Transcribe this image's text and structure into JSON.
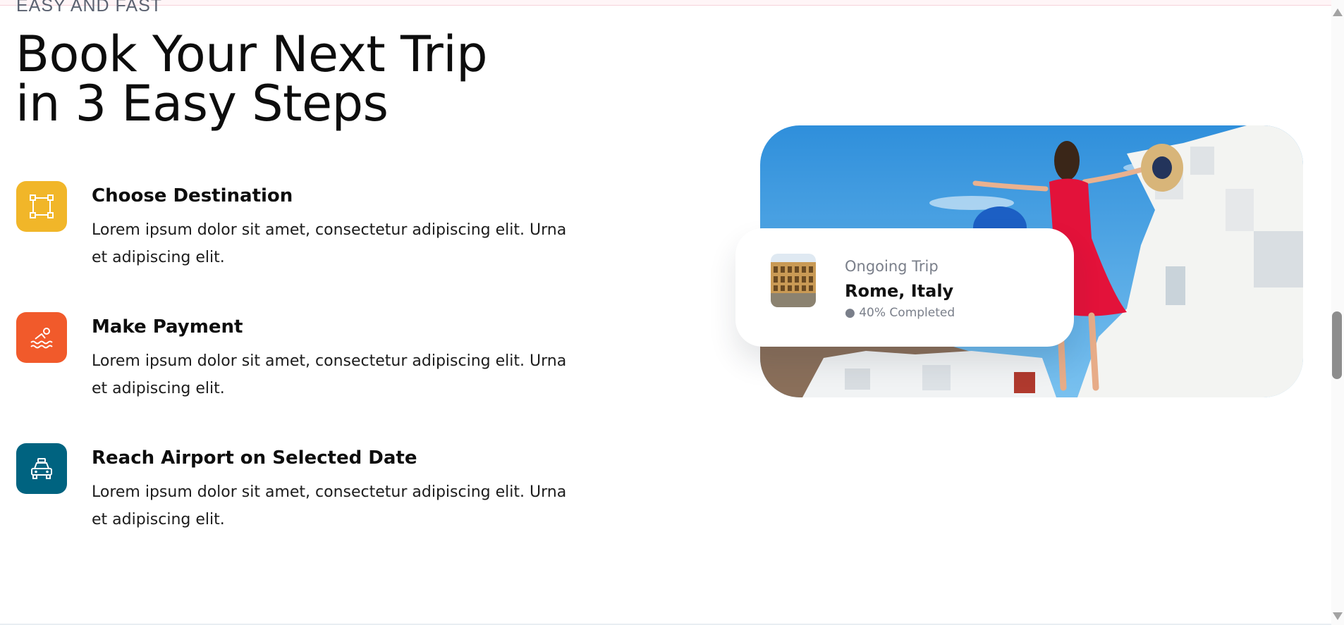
{
  "section": {
    "eyebrow": "EASY AND FAST",
    "title_line1": "Book Your Next Trip",
    "title_line2": "in 3 Easy Steps"
  },
  "steps": [
    {
      "title": "Choose Destination",
      "text": "Lorem ipsum dolor sit amet, consectetur adipiscing elit. Urna et adipiscing elit.",
      "icon": "selection-icon",
      "color": "#F1B629"
    },
    {
      "title": "Make Payment",
      "text": "Lorem ipsum dolor sit amet, consectetur adipiscing elit. Urna et adipiscing elit.",
      "icon": "swimmer-icon",
      "color": "#F15A2B"
    },
    {
      "title": "Reach Airport on Selected Date",
      "text": "Lorem ipsum dolor sit amet, consectetur adipiscing elit. Urna et adipiscing elit.",
      "icon": "taxi-icon",
      "color": "#006380"
    }
  ],
  "trip_card": {
    "label": "Ongoing Trip",
    "place": "Rome, Italy",
    "progress_text": "● 40% Completed",
    "progress": 0.4
  }
}
